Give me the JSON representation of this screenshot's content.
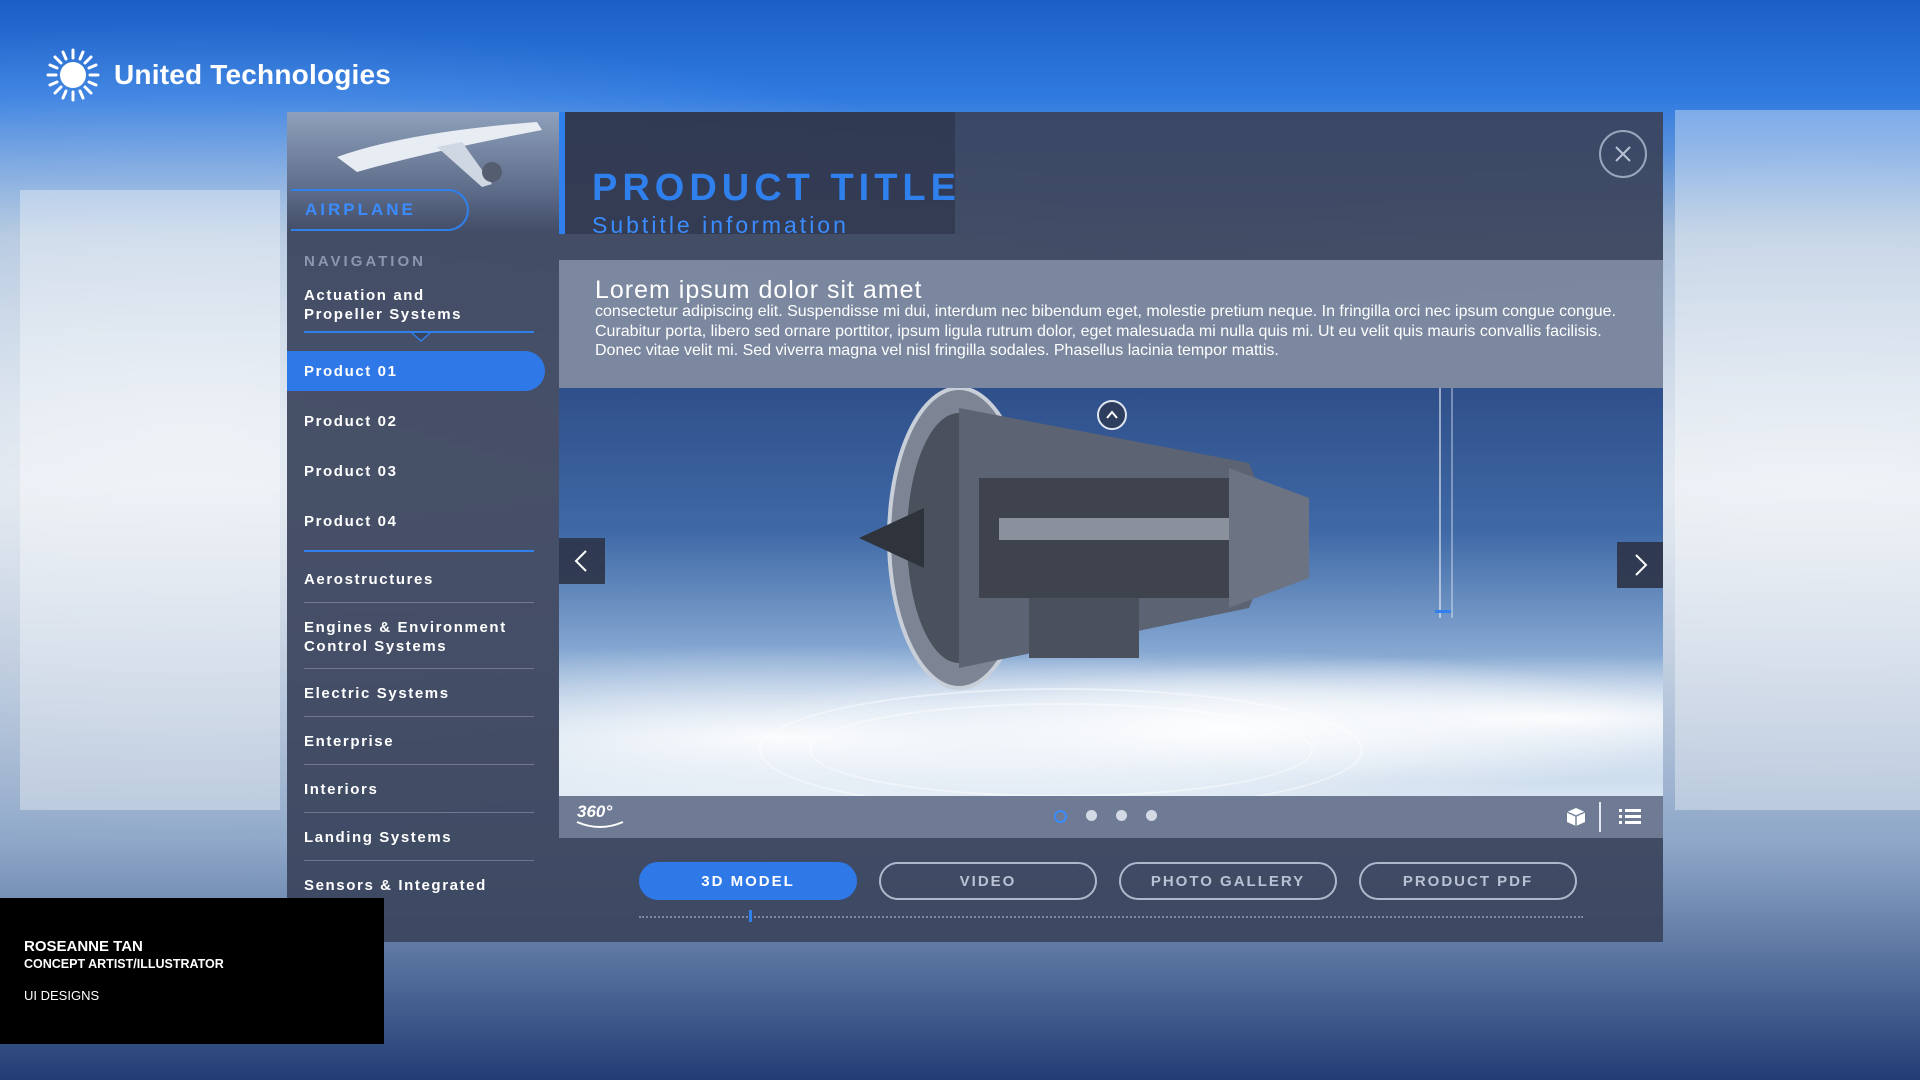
{
  "brand": {
    "name": "United Technologies",
    "logo_icon": "sunburst-logo-icon"
  },
  "sidebar": {
    "category_pill": "AIRPLANE",
    "nav_heading": "NAVIGATION",
    "group_title_line1": "Actuation and",
    "group_title_line2": "Propeller Systems",
    "products": [
      {
        "label": "Product 01",
        "active": true
      },
      {
        "label": "Product 02",
        "active": false
      },
      {
        "label": "Product 03",
        "active": false
      },
      {
        "label": "Product 04",
        "active": false
      }
    ],
    "categories": [
      {
        "line1": "Aerostructures",
        "line2": ""
      },
      {
        "line1": "Engines & Environment",
        "line2": "Control Systems"
      },
      {
        "line1": "Electric Systems",
        "line2": ""
      },
      {
        "line1": "Enterprise",
        "line2": ""
      },
      {
        "line1": "Interiors",
        "line2": ""
      },
      {
        "line1": "Landing Systems",
        "line2": ""
      },
      {
        "line1": "Sensors & Integrated",
        "line2": ""
      }
    ]
  },
  "main": {
    "title": "PRODUCT TITLE",
    "subtitle": "Subtitle information",
    "close_icon": "close-icon",
    "description_title": "Lorem ipsum dolor sit amet",
    "description_body": "consectetur adipiscing elit. Suspendisse mi dui, interdum nec bibendum eget, molestie pretium neque. In fringilla orci nec ipsum congue congue. Curabitur porta, libero sed ornare porttitor, ipsum ligula rutrum dolor, eget malesuada mi nulla quis mi. Ut eu velit quis mauris convallis facilisis. Donec vitae velit mi. Sed viverra magna vel nisl fringilla sodales. Phasellus lacinia tempor mattis.",
    "viewer": {
      "badge_360": "360°",
      "carousel_dot_count": 4,
      "active_dot_index": 0,
      "icons": [
        "up-arrow-icon",
        "chevron-left-icon",
        "chevron-right-icon",
        "cube-icon",
        "list-icon"
      ]
    },
    "tabs": [
      {
        "label": "3D MODEL",
        "active": true
      },
      {
        "label": "VIDEO",
        "active": false
      },
      {
        "label": "PHOTO GALLERY",
        "active": false
      },
      {
        "label": "PRODUCT PDF",
        "active": false
      }
    ]
  },
  "credit": {
    "name": "ROSEANNE TAN",
    "role": "CONCEPT ARTIST/ILLUSTRATOR",
    "section": "UI DESIGNS"
  },
  "colors": {
    "accent": "#2f80ec",
    "panel": "#3a445c",
    "credit_bg": "#000000"
  }
}
